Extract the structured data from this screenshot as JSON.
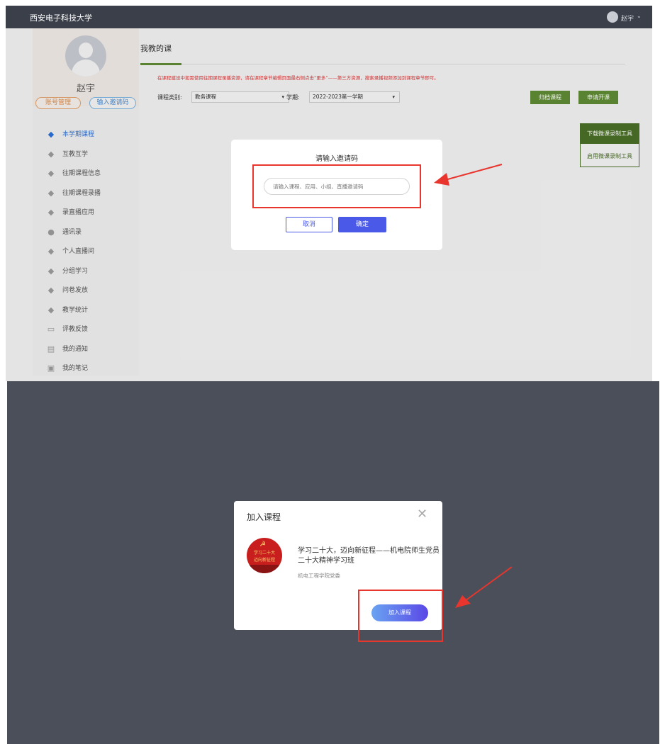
{
  "topbar": {
    "university": "西安电子科技大学",
    "username": "赵宇",
    "caret": "⌄"
  },
  "profile": {
    "name": "赵宇",
    "account_btn": "账号管理",
    "invite_btn": "输入邀请码"
  },
  "sidebar": {
    "items": [
      {
        "label": "本学期课程",
        "icon": "graduation-cap-icon"
      },
      {
        "label": "互教互学",
        "icon": "graduation-cap-icon"
      },
      {
        "label": "往期课程信息",
        "icon": "graduation-cap-icon"
      },
      {
        "label": "往期课程录播",
        "icon": "graduation-cap-icon"
      },
      {
        "label": "录直播应用",
        "icon": "graduation-cap-icon"
      },
      {
        "label": "通讯录",
        "icon": "contacts-icon"
      },
      {
        "label": "个人直播间",
        "icon": "graduation-cap-icon"
      },
      {
        "label": "分组学习",
        "icon": "graduation-cap-icon"
      },
      {
        "label": "问卷发放",
        "icon": "graduation-cap-icon"
      },
      {
        "label": "教学统计",
        "icon": "graduation-cap-icon"
      },
      {
        "label": "评教反馈",
        "icon": "monitor-icon"
      },
      {
        "label": "我的通知",
        "icon": "printer-icon"
      },
      {
        "label": "我的笔记",
        "icon": "note-icon"
      }
    ]
  },
  "main": {
    "title": "我教的课",
    "notice": "在课程建设中如需使用往期课程录播资源，请在课程章节编辑页面最右侧点击“更多”——第三方资源，搜索录播视频添加到课程章节即可。",
    "filter_type_label": "课程类别:",
    "filter_type_value": "教务课程",
    "filter_term_label": "学期:",
    "filter_term_value": "2022-2023第一学期",
    "archive_btn": "归档课程",
    "apply_btn": "申请开课",
    "tool_download": "下载微课录制工具",
    "tool_enable": "启用微课录制工具"
  },
  "invite_dialog": {
    "title": "请输入邀请码",
    "placeholder": "请输入课程、应用、小组、直播邀请码",
    "cancel": "取消",
    "confirm": "确定"
  },
  "join_dialog": {
    "title": "加入课程",
    "close": "✕",
    "logo_line1": "学习二十大",
    "logo_line2": "迈向新征程",
    "course_name": "学习二十大，迈向新征程——机电院师生党员二十大精神学习班",
    "org": "机电工程学院党委",
    "join_btn": "加入课程"
  },
  "colors": {
    "accent_green": "#5f8b34",
    "accent_blue": "#4b59e8",
    "highlight_red": "#e8352e",
    "overlay_dark": "#4a4f59"
  }
}
